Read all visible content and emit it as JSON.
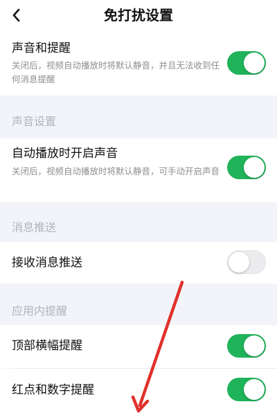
{
  "header": {
    "title": "免打扰设置",
    "back_icon": "chevron-left-icon"
  },
  "sound_alert": {
    "title": "声音和提醒",
    "desc": "关闭后，视频自动播放时将默认静音，并且无法收到任何消息提醒",
    "enabled": true
  },
  "sound_settings": {
    "header": "声音设置",
    "autoplay_sound": {
      "title": "自动播放时开启声音",
      "desc": "关闭后，视频自动播放时将默认静音，可手动开启声音",
      "enabled": true
    }
  },
  "push": {
    "header": "消息推送",
    "receive_push": {
      "title": "接收消息推送",
      "enabled": false
    }
  },
  "in_app": {
    "header": "应用内提醒",
    "top_banner": {
      "title": "顶部横幅提醒",
      "enabled": true
    },
    "badge": {
      "title": "红点和数字提醒",
      "enabled": true
    }
  },
  "colors": {
    "toggle_on": "#1fb35a",
    "toggle_off": "#ececee",
    "section_bg": "#f3f4f9",
    "annotation_arrow": "#e0312c"
  }
}
